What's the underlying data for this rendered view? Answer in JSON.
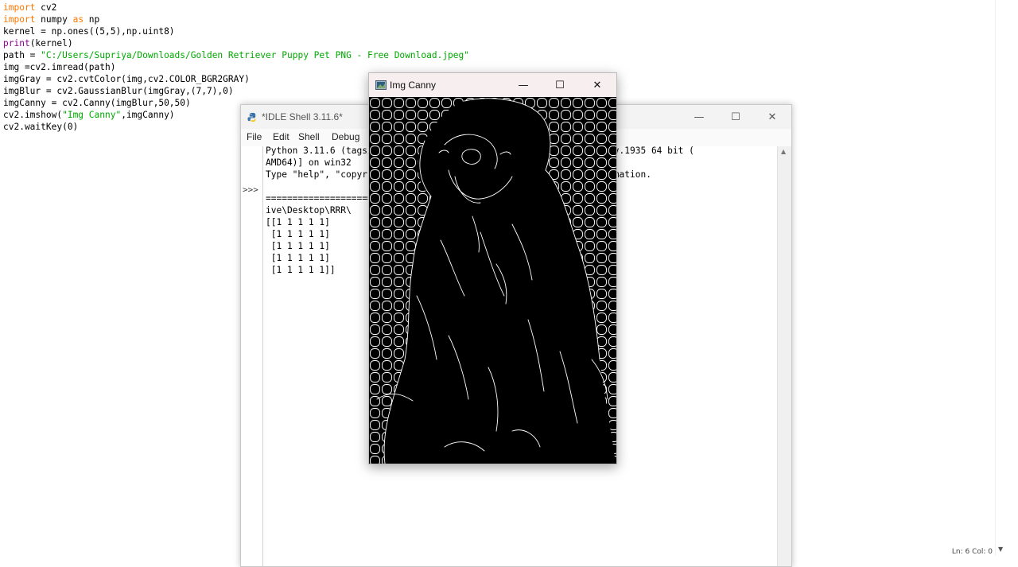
{
  "editor": {
    "lines": [
      [
        {
          "t": "import",
          "c": "kw"
        },
        {
          "t": " cv2"
        }
      ],
      [
        {
          "t": "import",
          "c": "kw"
        },
        {
          "t": " numpy "
        },
        {
          "t": "as",
          "c": "kw"
        },
        {
          "t": " np"
        }
      ],
      [
        {
          "t": "kernel = np.ones((5,5),np.uint8)"
        }
      ],
      [
        {
          "t": "print",
          "c": "bi"
        },
        {
          "t": "(kernel)"
        }
      ],
      [
        {
          "t": "path = "
        },
        {
          "t": "\"C:/Users/Supriya/Downloads/Golden Retriever Puppy Pet PNG - Free Download.jpeg\"",
          "c": "str"
        }
      ],
      [
        {
          "t": "img =cv2.imread(path)"
        }
      ],
      [
        {
          "t": "imgGray = cv2.cvtColor(img,cv2.COLOR_BGR2GRAY)"
        }
      ],
      [
        {
          "t": "imgBlur = cv2.GaussianBlur(imgGray,(7,7),0)"
        }
      ],
      [
        {
          "t": "imgCanny = cv2.Canny(imgBlur,50,50)"
        }
      ],
      [
        {
          "t": "cv2.imshow("
        },
        {
          "t": "\"Img Canny\"",
          "c": "str"
        },
        {
          "t": ",imgCanny)"
        }
      ],
      [
        {
          "t": "cv2.waitKey(0)"
        }
      ]
    ],
    "status": "Ln: 6  Col: 0"
  },
  "idle_shell": {
    "title": "*IDLE Shell 3.11.6*",
    "menu": [
      "File",
      "Edit",
      "Shell",
      "Debug"
    ],
    "prompt": ">>>",
    "lines": [
      "Python 3.11.6 (tags/v3.11.6:8b6ee5b, Oct  2 2023, 14:57:12) [MSC v.1935 64 bit (",
      "AMD64)] on win32",
      "Type \"help\", \"copyright\", \"credits\" or \"license()\" for more information.",
      "",
      "============================ RESTART: C:\\Users\\Supriya\\OneDr",
      "ive\\Desktop\\RRR\\                          ==================",
      "[[1 1 1 1 1]",
      " [1 1 1 1 1]",
      " [1 1 1 1 1]",
      " [1 1 1 1 1]",
      " [1 1 1 1 1]]"
    ]
  },
  "canny_window": {
    "title": "Img Canny"
  },
  "colors": {
    "keyword": "#ff7700",
    "string": "#00aa00",
    "builtin": "#900090"
  }
}
